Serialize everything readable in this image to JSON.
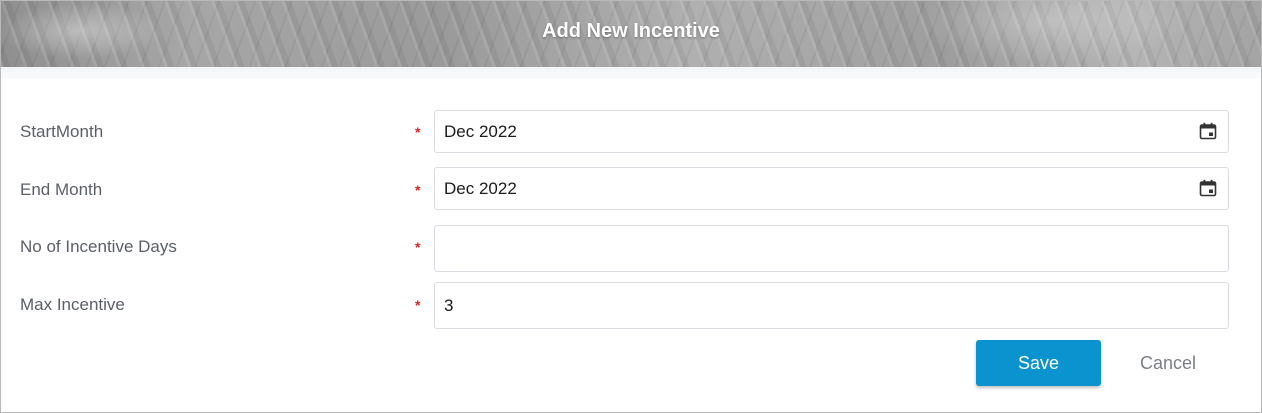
{
  "dialog": {
    "title": "Add New Incentive",
    "fields": [
      {
        "label": "StartMonth",
        "value": "Dec 2022",
        "required_mark": "*",
        "icon": "calendar-icon"
      },
      {
        "label": "End Month",
        "value": "Dec 2022",
        "required_mark": "*",
        "icon": "calendar-icon"
      },
      {
        "label": "No of Incentive Days",
        "value": "",
        "required_mark": "*"
      },
      {
        "label": "Max Incentive",
        "value": "3",
        "required_mark": "*"
      }
    ],
    "save_label": "Save",
    "cancel_label": "Cancel"
  },
  "colors": {
    "primary_button": "#0b93d0",
    "required": "#e02424",
    "label": "#5a5f66"
  }
}
